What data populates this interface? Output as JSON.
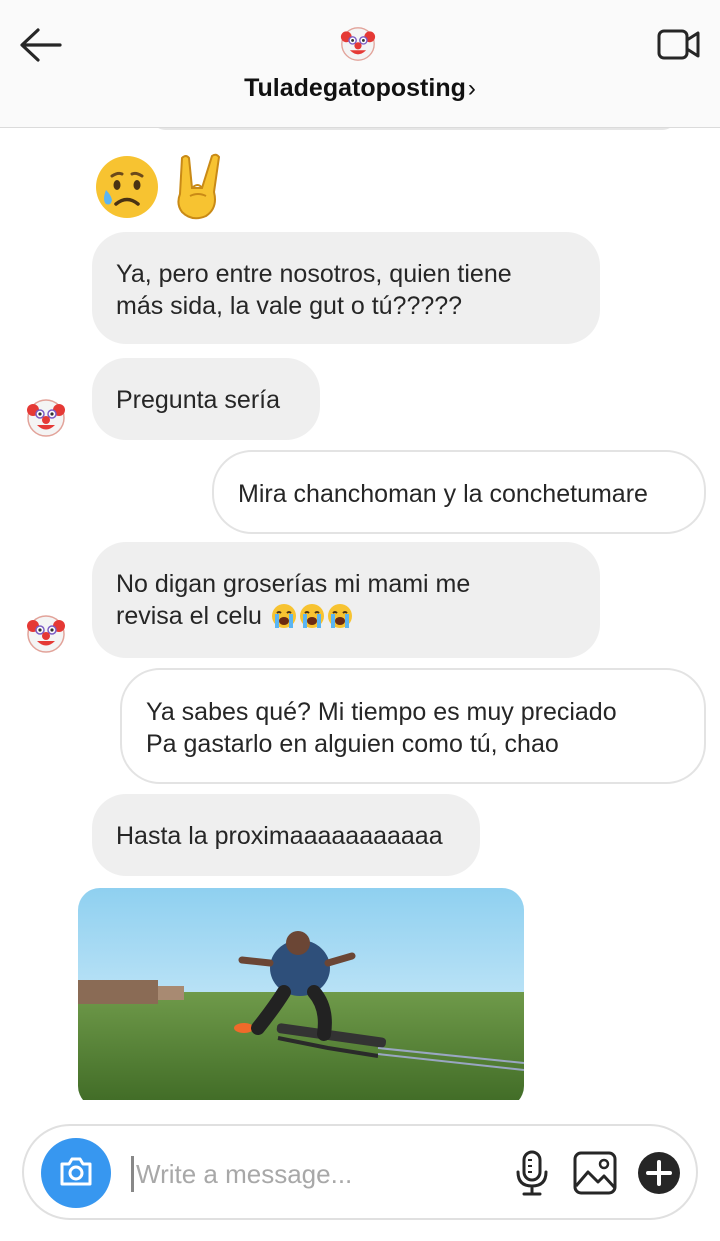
{
  "header": {
    "title": "Tuladegatoposting",
    "title_chevron": "›",
    "icons": {
      "back": "arrow-left-icon",
      "video": "video-call-icon",
      "avatar": "clown-face-emoji"
    }
  },
  "messages": [
    {
      "direction": "in",
      "type": "emoji",
      "emojis": [
        "sad-but-relieved-face-emoji",
        "sign-of-the-horns-emoji"
      ]
    },
    {
      "direction": "in",
      "type": "text",
      "lines": [
        "Ya, pero entre nosotros, quien tiene",
        "más sida, la vale gut o tú?????"
      ]
    },
    {
      "direction": "in",
      "type": "text",
      "lines": [
        "Pregunta sería"
      ],
      "avatar": true
    },
    {
      "direction": "out",
      "type": "text",
      "lines": [
        "Mira chanchoman y la conchetumare"
      ]
    },
    {
      "direction": "in",
      "type": "text",
      "lines": [
        "No digan groserías mi mami me",
        "revisa el celu"
      ],
      "trailing_emojis": [
        "loudly-crying-face-emoji",
        "loudly-crying-face-emoji",
        "loudly-crying-face-emoji"
      ],
      "avatar": true
    },
    {
      "direction": "out",
      "type": "text",
      "lines": [
        "Ya sabes qué? Mi tiempo es muy preciado",
        "Pa gastarlo en alguien como tú, chao"
      ]
    },
    {
      "direction": "in",
      "type": "text",
      "lines": [
        "Hasta la proximaaaaaaaaaaa"
      ]
    },
    {
      "direction": "in",
      "type": "media",
      "description_icon": "gif-thumbnail"
    }
  ],
  "composer": {
    "placeholder": "Write a message...",
    "value": "",
    "icons": {
      "camera": "camera-icon",
      "mic": "microphone-icon",
      "gallery": "image-gallery-icon",
      "plus": "plus-circle-icon"
    }
  },
  "colors": {
    "accent": "#3797f0",
    "incoming_bubble": "#efefef",
    "outgoing_border": "#e3e3e3",
    "text": "#262626",
    "placeholder": "#a8a8a8"
  }
}
